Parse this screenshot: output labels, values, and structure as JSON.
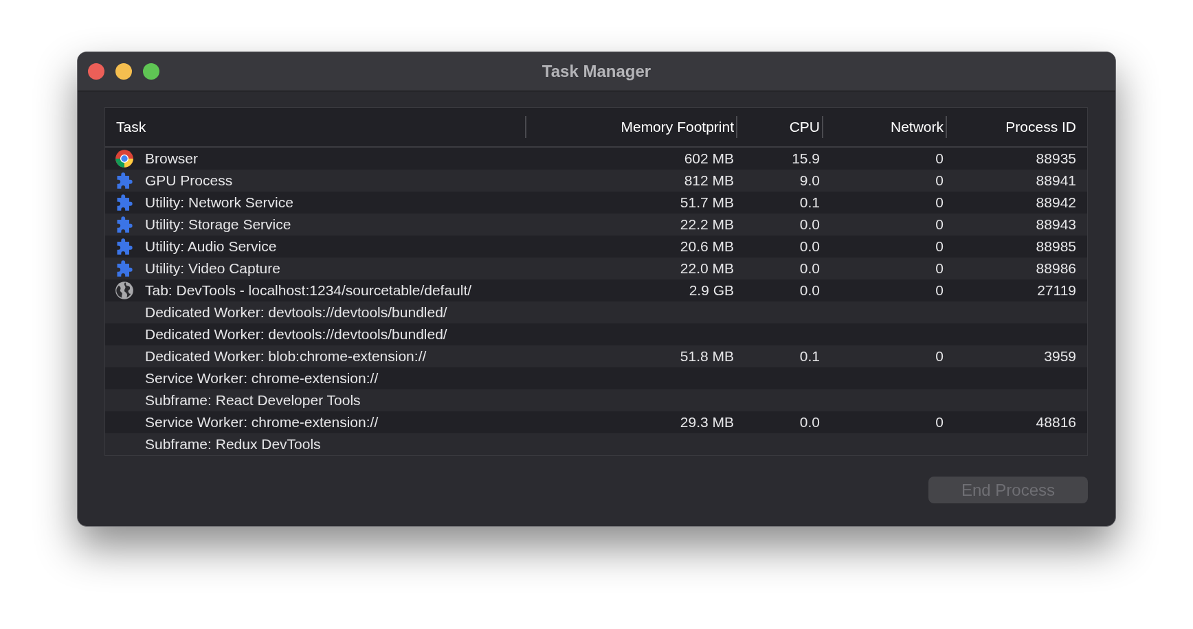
{
  "window": {
    "title": "Task Manager"
  },
  "table": {
    "columns": [
      "Task",
      "Memory Footprint",
      "CPU",
      "Network",
      "Process ID"
    ],
    "rows": [
      {
        "kind": "chrome",
        "task": "Browser",
        "memory": "602 MB",
        "cpu": "15.9",
        "network": "0",
        "pid": "88935"
      },
      {
        "kind": "extension",
        "task": "GPU Process",
        "memory": "812 MB",
        "cpu": "9.0",
        "network": "0",
        "pid": "88941"
      },
      {
        "kind": "extension",
        "task": "Utility: Network Service",
        "memory": "51.7 MB",
        "cpu": "0.1",
        "network": "0",
        "pid": "88942"
      },
      {
        "kind": "extension",
        "task": "Utility: Storage Service",
        "memory": "22.2 MB",
        "cpu": "0.0",
        "network": "0",
        "pid": "88943"
      },
      {
        "kind": "extension",
        "task": "Utility: Audio Service",
        "memory": "20.6 MB",
        "cpu": "0.0",
        "network": "0",
        "pid": "88985"
      },
      {
        "kind": "extension",
        "task": "Utility: Video Capture",
        "memory": "22.0 MB",
        "cpu": "0.0",
        "network": "0",
        "pid": "88986"
      },
      {
        "kind": "globe",
        "task": "Tab: DevTools - localhost:1234/sourcetable/default/",
        "memory": "2.9 GB",
        "cpu": "0.0",
        "network": "0",
        "pid": "27119"
      },
      {
        "kind": "none",
        "task": "Dedicated Worker: devtools://devtools/bundled/"
      },
      {
        "kind": "none",
        "task": "Dedicated Worker: devtools://devtools/bundled/"
      },
      {
        "kind": "none",
        "task": "Dedicated Worker: blob:chrome-extension://",
        "memory": "51.8 MB",
        "cpu": "0.1",
        "network": "0",
        "pid": "3959"
      },
      {
        "kind": "none",
        "task": "Service Worker: chrome-extension://"
      },
      {
        "kind": "none",
        "task": "Subframe: React Developer Tools"
      },
      {
        "kind": "none",
        "task": "Service Worker: chrome-extension://",
        "memory": "29.3 MB",
        "cpu": "0.0",
        "network": "0",
        "pid": "48816"
      },
      {
        "kind": "none",
        "task": "Subframe: Redux DevTools"
      }
    ]
  },
  "end_button": {
    "label": "End Process",
    "disabled": true
  }
}
